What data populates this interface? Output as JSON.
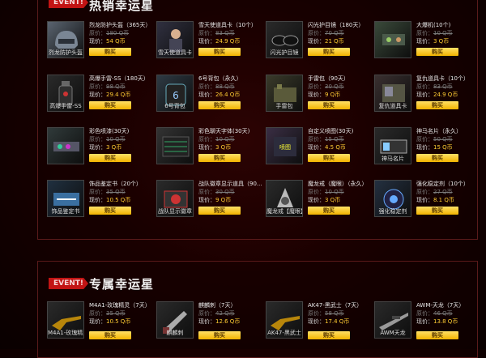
{
  "sections": [
    {
      "event_tag": "EVENT!",
      "title": "热销幸运星",
      "items": [
        {
          "name": "烈龙防护头盔（365天）",
          "orig_label": "原价：",
          "orig": "180 Q币",
          "now_label": "现价：",
          "now": "54 Q币",
          "buy": "购买",
          "caption": "烈龙防护头盔",
          "icon": "helmet-icon",
          "color": "#5a6470"
        },
        {
          "name": "雪天使道具卡（10个）",
          "orig_label": "原价：",
          "orig": "83 Q币",
          "now_label": "现价：",
          "now": "24.9 Q币",
          "buy": "购买",
          "caption": "雪天使道具卡",
          "icon": "character-card-icon",
          "color": "#303040"
        },
        {
          "name": "闪光护目镜（180天）",
          "orig_label": "原价：",
          "orig": "70 Q币",
          "now_label": "现价：",
          "now": "21 Q币",
          "buy": "购买",
          "caption": "闪光护目镜",
          "icon": "goggles-icon",
          "color": "#2a2a2a"
        },
        {
          "name": "大爆机(10个)",
          "orig_label": "原价：",
          "orig": "10 Q币",
          "now_label": "现价：",
          "now": "3 Q币",
          "buy": "购买",
          "caption": "",
          "icon": "device-icon",
          "color": "#3a4a3a"
        },
        {
          "name": "高爆手雷-SS（180天）",
          "orig_label": "原价：",
          "orig": "98 Q币",
          "now_label": "现价：",
          "now": "29.4 Q币",
          "buy": "购买",
          "caption": "高爆手雷-SS",
          "icon": "grenade-icon",
          "color": "#2a2a2a"
        },
        {
          "name": "6号背包（永久）",
          "orig_label": "原价：",
          "orig": "88 Q币",
          "now_label": "现价：",
          "now": "26.4 Q币",
          "buy": "购买",
          "caption": "6号背包",
          "icon": "backpack-icon",
          "color": "#2e3a44"
        },
        {
          "name": "手雷包（90天）",
          "orig_label": "原价：",
          "orig": "30 Q币",
          "now_label": "现价：",
          "now": "9 Q币",
          "buy": "购买",
          "caption": "手雷包",
          "icon": "grenade-pack-icon",
          "color": "#3a3a2a"
        },
        {
          "name": "复仇道具卡（10个）",
          "orig_label": "原价：",
          "orig": "83 Q币",
          "now_label": "现价：",
          "now": "24.9 Q币",
          "buy": "购买",
          "caption": "复仇道具卡",
          "icon": "card-icon",
          "color": "#3a3030"
        },
        {
          "name": "彩色喷漆(30天)",
          "orig_label": "原价：",
          "orig": "10 Q币",
          "now_label": "现价：",
          "now": "3 Q币",
          "buy": "购买",
          "caption": "",
          "icon": "spray-icon",
          "color": "#303a3a"
        },
        {
          "name": "彩色聊天字体(30天)",
          "orig_label": "原价：",
          "orig": "10 Q币",
          "now_label": "现价：",
          "now": "3 Q币",
          "buy": "购买",
          "caption": "",
          "icon": "chat-font-icon",
          "color": "#333"
        },
        {
          "name": "自定义喷图(30天)",
          "orig_label": "原价：",
          "orig": "15 Q币",
          "now_label": "现价：",
          "now": "4.5 Q币",
          "buy": "购买",
          "caption": "",
          "icon": "custom-spray-icon",
          "color": "#3a2e44"
        },
        {
          "name": "神马名片（永久）",
          "orig_label": "原价：",
          "orig": "50 Q币",
          "now_label": "现价：",
          "now": "15 Q币",
          "buy": "购买",
          "caption": "神马名片",
          "icon": "namecard-icon",
          "color": "#2a2a2a"
        },
        {
          "name": "饰品鉴定书（20个）",
          "orig_label": "原价：",
          "orig": "35 Q币",
          "now_label": "现价：",
          "now": "10.5 Q币",
          "buy": "购买",
          "caption": "饰品鉴定书",
          "icon": "appraisal-icon",
          "color": "#203040"
        },
        {
          "name": "战队徽章显示道具（90...",
          "orig_label": "原价：",
          "orig": "30 Q币",
          "now_label": "现价：",
          "now": "9 Q币",
          "buy": "购买",
          "caption": "战队显示徽章",
          "icon": "badge-icon",
          "color": "#2a2a2a"
        },
        {
          "name": "魔龙戒（魔眼）（永久）",
          "orig_label": "原价：",
          "orig": "10 Q币",
          "now_label": "现价：",
          "now": "3 Q币",
          "buy": "购买",
          "caption": "魔龙戒【魔眼】",
          "icon": "ring-icon",
          "color": "#2a2a2a"
        },
        {
          "name": "强化稳定剂（10个）",
          "orig_label": "原价：",
          "orig": "27 Q币",
          "now_label": "现价：",
          "now": "8.1 Q币",
          "buy": "购买",
          "caption": "强化稳定剂",
          "icon": "stabilizer-icon",
          "color": "#243040"
        }
      ]
    },
    {
      "event_tag": "EVENT!",
      "title": "专属幸运星",
      "items": [
        {
          "name": "M4A1-玫瑰精灵（7天）",
          "orig_label": "原价：",
          "orig": "35 Q币",
          "now_label": "现价：",
          "now": "10.5 Q币",
          "buy": "购买",
          "caption": "M4A1-玫瑰精灵",
          "icon": "rifle-icon",
          "color": "#2a2a2a"
        },
        {
          "name": "麒麟刺（7天）",
          "orig_label": "原价：",
          "orig": "42 Q币",
          "now_label": "现价：",
          "now": "12.6 Q币",
          "buy": "购买",
          "caption": "麒麟刺",
          "icon": "blade-icon",
          "color": "#2a2a2a"
        },
        {
          "name": "AK47-黑武士（7天）",
          "orig_label": "原价：",
          "orig": "58 Q币",
          "now_label": "现价：",
          "now": "17.4 Q币",
          "buy": "购买",
          "caption": "AK47-黑武士",
          "icon": "rifle-icon",
          "color": "#2a2a2a"
        },
        {
          "name": "AWM-天龙（7天）",
          "orig_label": "原价：",
          "orig": "46 Q币",
          "now_label": "现价：",
          "now": "13.8 Q币",
          "buy": "购买",
          "caption": "AWM天龙",
          "icon": "sniper-icon",
          "color": "#2a2a2a"
        }
      ]
    }
  ]
}
